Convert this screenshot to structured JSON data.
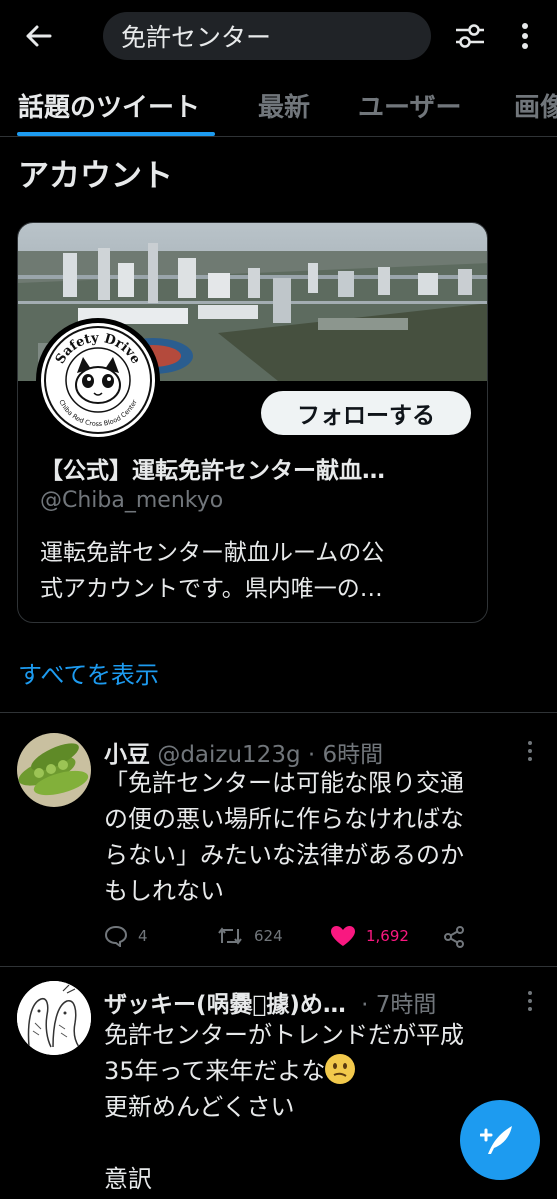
{
  "search": {
    "query": "免許センター"
  },
  "tabs": [
    {
      "label": "話題のツイート"
    },
    {
      "label": "最新"
    },
    {
      "label": "ユーザー"
    },
    {
      "label": "画像"
    }
  ],
  "section": {
    "title": "アカウント"
  },
  "account_card": {
    "avatar_text_top": "Safety Drive",
    "avatar_text_bottom": "Chiba Red Cross Blood Center",
    "follow_label": "フォローする",
    "name": "【公式】運転免許センター献血…",
    "handle": "@Chiba_menkyo",
    "bio_line1": "運転免許センター献血ルームの公",
    "bio_line2": "式アカウントです。県内唯一の…"
  },
  "show_all": "すべてを表示",
  "tweets": [
    {
      "name": "小豆",
      "handle": "@daizu123g",
      "time": "· 6時間",
      "lines": [
        "「免許センターは可能な限り交通",
        "の便の悪い場所に作らなければな",
        "らない」みたいな法律があるのか",
        "もしれない"
      ],
      "replies": "4",
      "retweets": "624",
      "likes": "1,692"
    },
    {
      "name": "ザッキー(㖞爨𥪸據)め…",
      "time": "· 7時間",
      "lines": [
        "免許センターがトレンドだが平成",
        "35年って来年だよな",
        "更新めんどくさい",
        "",
        "意訳"
      ]
    }
  ],
  "colors": {
    "accent": "#1d9bf0",
    "like": "#f91880",
    "background": "#000000",
    "secondary_text": "#71767b"
  },
  "icons": {
    "back": "arrow-left-icon",
    "filter": "sliders-icon",
    "more": "vertical-ellipsis-icon",
    "reply": "speech-bubble-icon",
    "retweet": "retweet-icon",
    "like": "heart-icon",
    "share": "share-icon",
    "compose": "compose-feather-icon"
  }
}
